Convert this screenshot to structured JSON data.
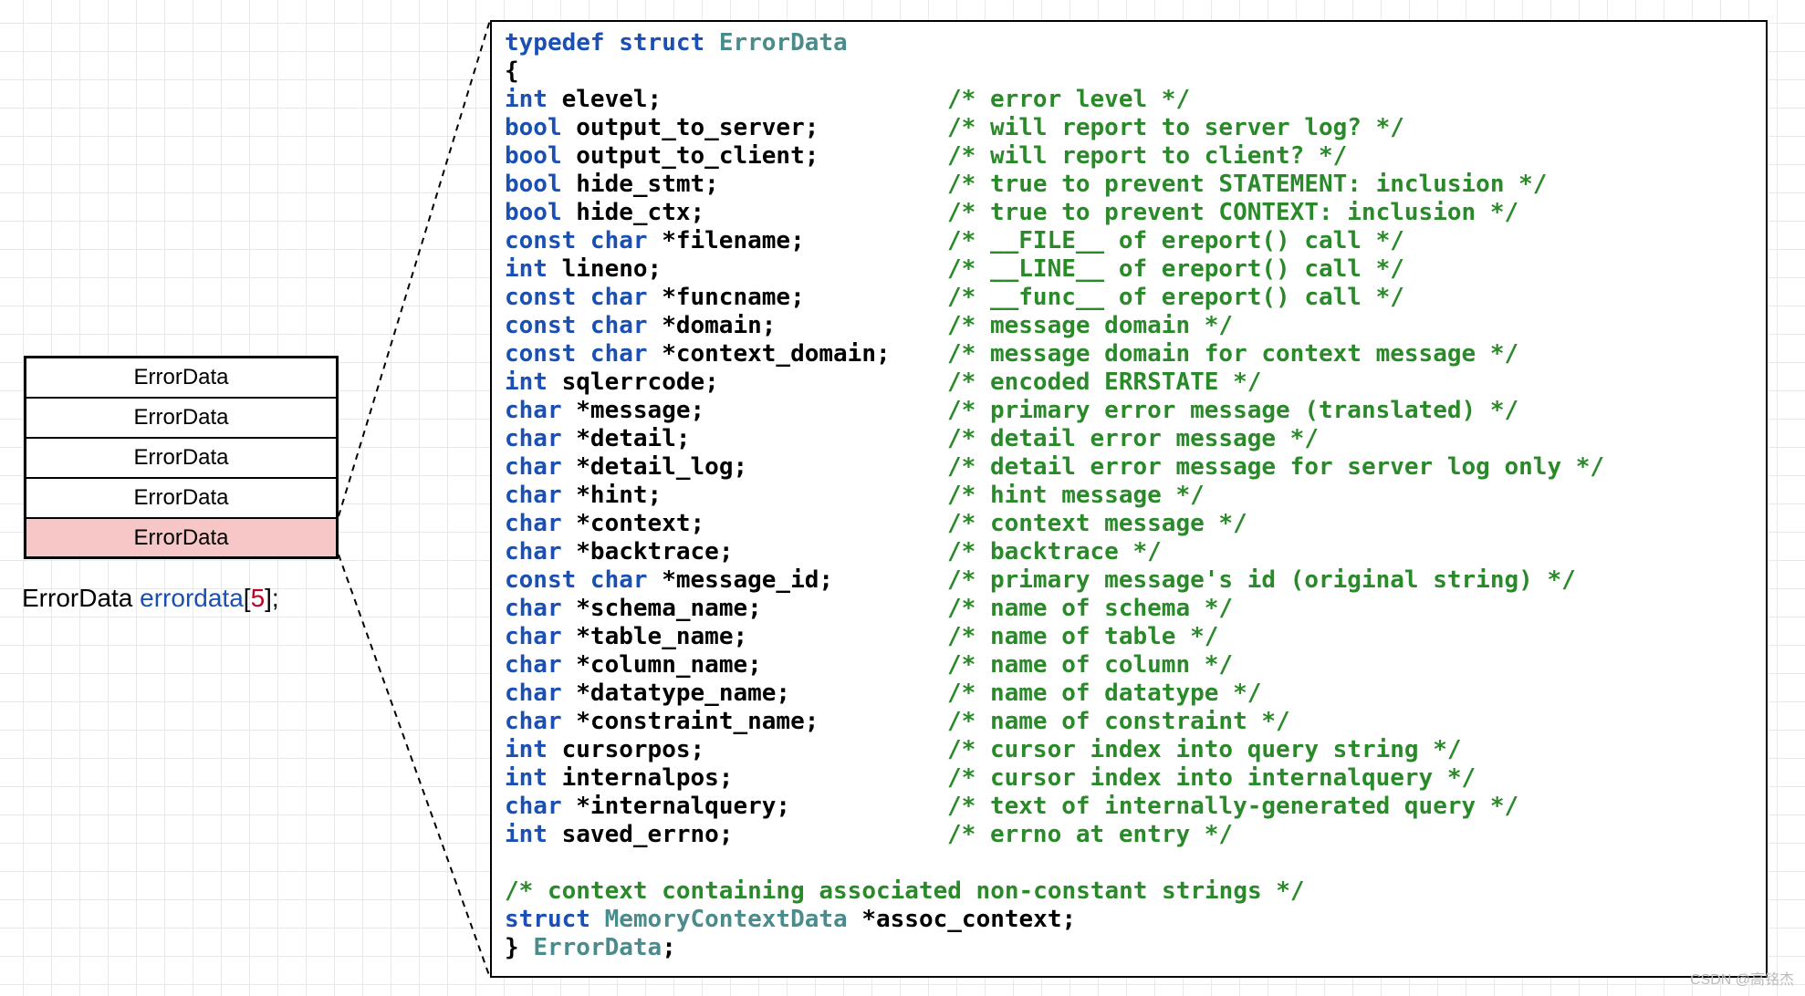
{
  "stack": {
    "cells": [
      "ErrorData",
      "ErrorData",
      "ErrorData",
      "ErrorData",
      "ErrorData"
    ],
    "highlight_index": 4
  },
  "declaration": {
    "type": "ErrorData",
    "name": "errordata",
    "size": "5"
  },
  "code": {
    "header": {
      "kw1": "typedef",
      "kw2": "struct",
      "type": "ErrorData",
      "open": "{"
    },
    "fields": [
      {
        "t": "int",
        "id": "elevel;",
        "c": "/* error level */"
      },
      {
        "t": "bool",
        "id": "output_to_server;",
        "c": "/* will report to server log? */"
      },
      {
        "t": "bool",
        "id": "output_to_client;",
        "c": "/* will report to client? */"
      },
      {
        "t": "bool",
        "id": "hide_stmt;",
        "c": "/* true to prevent STATEMENT: inclusion */"
      },
      {
        "t": "bool",
        "id": "hide_ctx;",
        "c": "/* true to prevent CONTEXT: inclusion */"
      },
      {
        "t": "const char",
        "id": "*filename;",
        "c": "/* __FILE__ of ereport() call */"
      },
      {
        "t": "int",
        "id": "lineno;",
        "c": "/* __LINE__ of ereport() call */"
      },
      {
        "t": "const char",
        "id": "*funcname;",
        "c": "/* __func__ of ereport() call */"
      },
      {
        "t": "const char",
        "id": "*domain;",
        "c": "/* message domain */"
      },
      {
        "t": "const char",
        "id": "*context_domain;",
        "c": "/* message domain for context message */"
      },
      {
        "t": "int",
        "id": "sqlerrcode;",
        "c": "/* encoded ERRSTATE */"
      },
      {
        "t": "char",
        "id": "*message;",
        "c": "/* primary error message (translated) */"
      },
      {
        "t": "char",
        "id": "*detail;",
        "c": "/* detail error message */"
      },
      {
        "t": "char",
        "id": "*detail_log;",
        "c": "/* detail error message for server log only */"
      },
      {
        "t": "char",
        "id": "*hint;",
        "c": "/* hint message */"
      },
      {
        "t": "char",
        "id": "*context;",
        "c": "/* context message */"
      },
      {
        "t": "char",
        "id": "*backtrace;",
        "c": "/* backtrace */"
      },
      {
        "t": "const char",
        "id": "*message_id;",
        "c": "/* primary message's id (original string) */"
      },
      {
        "t": "char",
        "id": "*schema_name;",
        "c": "/* name of schema */"
      },
      {
        "t": "char",
        "id": "*table_name;",
        "c": "/* name of table */"
      },
      {
        "t": "char",
        "id": "*column_name;",
        "c": "/* name of column */"
      },
      {
        "t": "char",
        "id": "*datatype_name;",
        "c": "/* name of datatype */"
      },
      {
        "t": "char",
        "id": "*constraint_name;",
        "c": "/* name of constraint */"
      },
      {
        "t": "int",
        "id": "cursorpos;",
        "c": "/* cursor index into query string */"
      },
      {
        "t": "int",
        "id": "internalpos;",
        "c": "/* cursor index into internalquery */"
      },
      {
        "t": "char",
        "id": "*internalquery;",
        "c": "/* text of internally-generated query */"
      },
      {
        "t": "int",
        "id": "saved_errno;",
        "c": "/* errno at entry */"
      }
    ],
    "footer": {
      "blank": "",
      "comment": "/* context containing associated non-constant strings */",
      "last_kw": "struct",
      "last_type": "MemoryContextData",
      "last_id": "*assoc_context;",
      "close": "}",
      "close_type": "ErrorData",
      "semi": ";"
    }
  },
  "watermark": "CSDN @高铭杰"
}
